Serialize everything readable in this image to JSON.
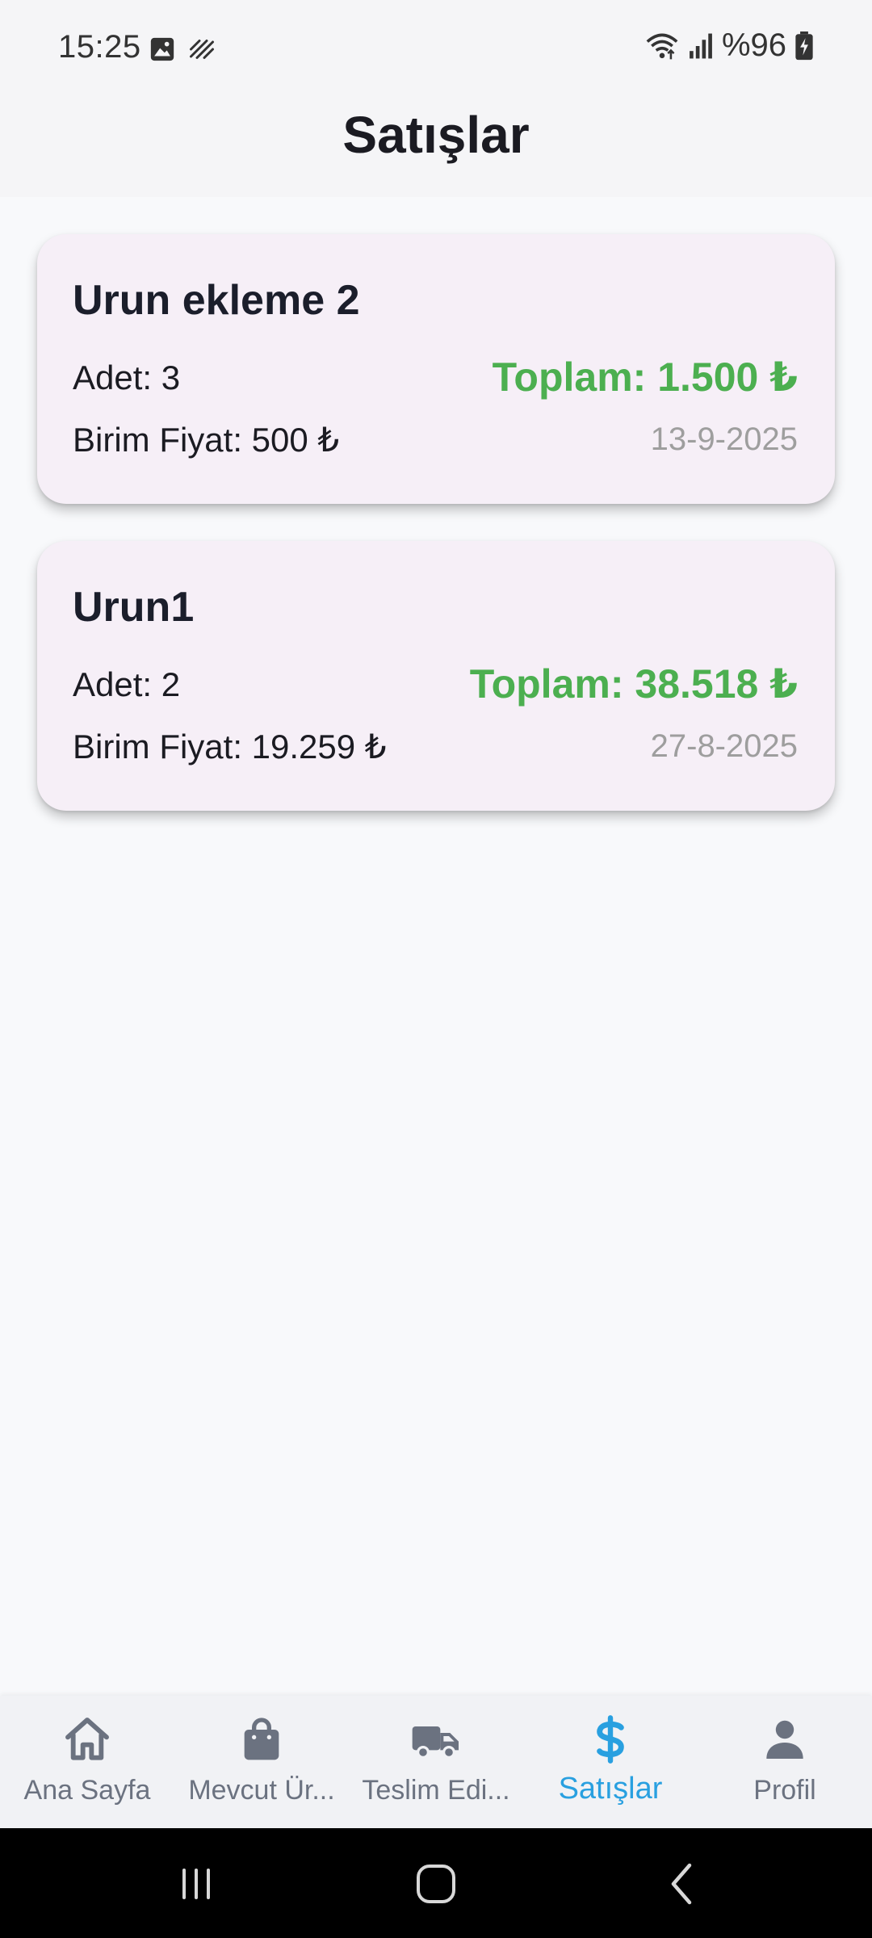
{
  "status": {
    "time": "15:25",
    "battery": "%96"
  },
  "header": {
    "title": "Satışlar"
  },
  "sales": [
    {
      "name": "Urun ekleme 2",
      "quantity": "Adet: 3",
      "unit_price": "Birim Fiyat: 500 ₺",
      "total": "Toplam: 1.500 ₺",
      "date": "13-9-2025"
    },
    {
      "name": "Urun1",
      "quantity": "Adet: 2",
      "unit_price": "Birim Fiyat: 19.259 ₺",
      "total": "Toplam: 38.518 ₺",
      "date": "27-8-2025"
    }
  ],
  "nav": {
    "items": [
      {
        "label": "Ana Sayfa",
        "icon": "home-icon"
      },
      {
        "label": "Mevcut Ür...",
        "icon": "shopping-bag-icon"
      },
      {
        "label": "Teslim Edi...",
        "icon": "truck-icon"
      },
      {
        "label": "Satışlar",
        "icon": "dollar-icon",
        "active": true
      },
      {
        "label": "Profil",
        "icon": "person-icon"
      }
    ]
  },
  "colors": {
    "accent": "#29a0e0",
    "total_green": "#4caf50",
    "card_bg": "#f6eff7"
  }
}
